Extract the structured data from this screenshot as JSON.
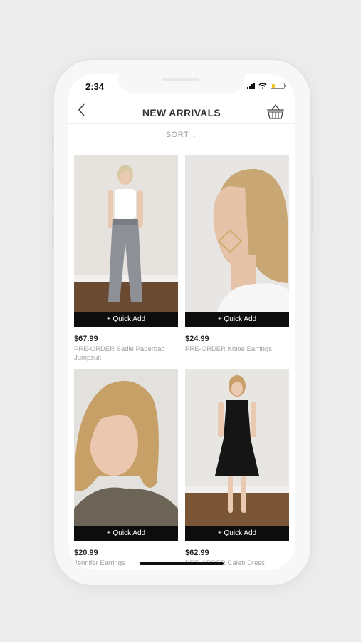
{
  "status_bar": {
    "time": "2:34"
  },
  "nav": {
    "title": "NEW ARRIVALS",
    "back_icon": "chevron-left-icon",
    "cart_icon": "basket-icon"
  },
  "sort": {
    "label": "SORT"
  },
  "products": [
    {
      "price": "$67.99",
      "name": "PRE-ORDER Sadie Paperbag Jumpsuit",
      "quick_add": "+ Quick Add"
    },
    {
      "price": "$24.99",
      "name": "PRE-ORDER Khloe Earrings",
      "quick_add": "+ Quick Add"
    },
    {
      "price": "$20.99",
      "name": "Jennifer Earrings",
      "quick_add": "+ Quick Add"
    },
    {
      "price": "$62.99",
      "name": "PRE-ORDER Caleb Dress",
      "quick_add": "+ Quick Add"
    }
  ],
  "colors": {
    "background": "#ececec",
    "quick_add_bg": "#0d0d0d",
    "battery": "#f0c419"
  }
}
